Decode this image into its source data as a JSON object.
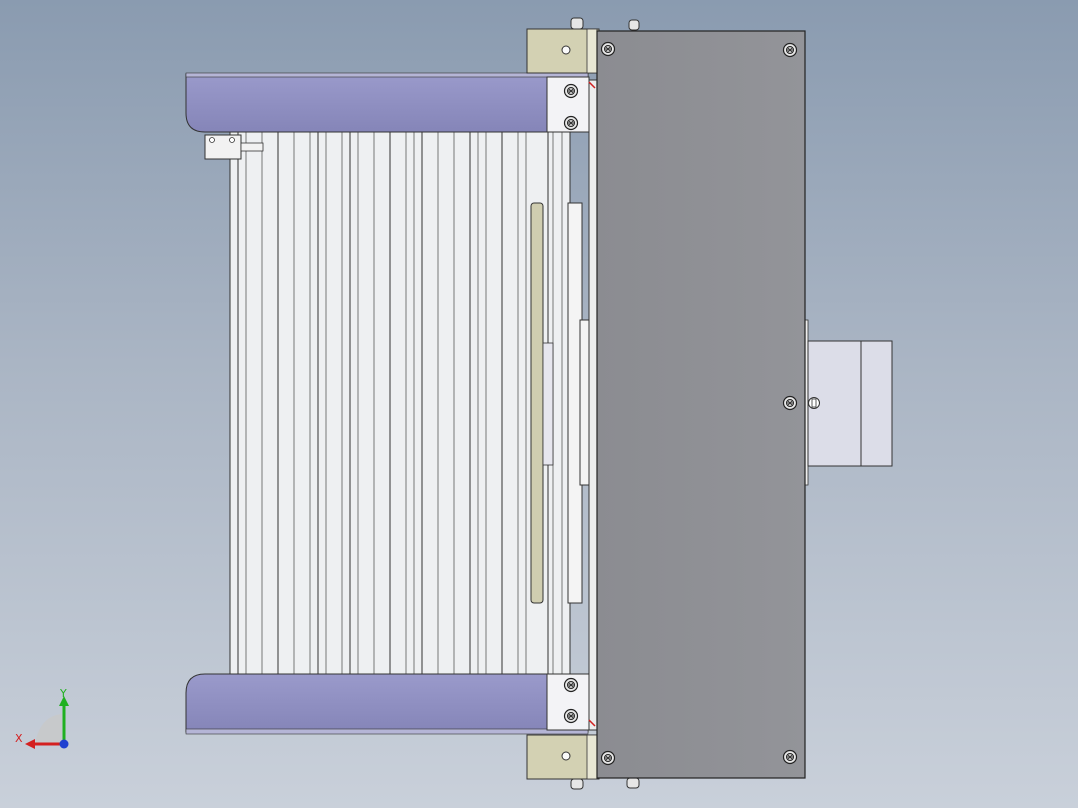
{
  "view": {
    "type": "cad-assembly-top-view",
    "background_top": "#8a9bb0",
    "background_bottom": "#c9d0da"
  },
  "colors": {
    "frame_purple": "#8f8fc0",
    "plate_gray": "#8d8e93",
    "bracket_khaki": "#d4d2b4",
    "slat_white": "#f0f1f3",
    "motor_mount": "#dcdde8",
    "axis_x": "#d42020",
    "axis_y": "#20b020",
    "axis_z": "#2040d0"
  },
  "triad": {
    "x_label": "X",
    "y_label": "Y"
  }
}
